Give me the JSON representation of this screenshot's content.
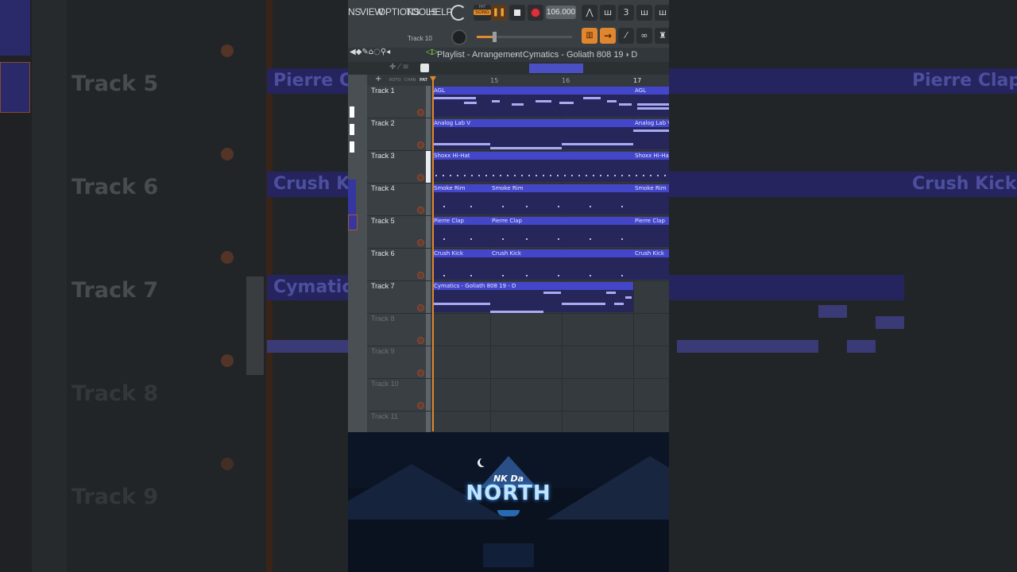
{
  "menu": {
    "items": [
      "NS",
      "VIEW",
      "OPTIONS",
      "TOOLS",
      "HELP"
    ]
  },
  "transport": {
    "pat_label": "PAT",
    "song_label": "SONG",
    "tempo": "106.000",
    "track_hint": "Track 10"
  },
  "titlebar": {
    "text": "Playlist - Arrangement",
    "sep": "›",
    "pattern": "Cymatics - Goliath 808 19 - D"
  },
  "ruler": {
    "bars": [
      "15",
      "16",
      "17"
    ],
    "labels": [
      "ROTO",
      "CHAN",
      "PAT"
    ]
  },
  "tracks": [
    {
      "name": "Track 1",
      "clips": [
        {
          "label": "AGL"
        },
        {
          "label": "AGL"
        }
      ]
    },
    {
      "name": "Track 2",
      "clips": [
        {
          "label": "Analog Lab V"
        },
        {
          "label": "Analog Lab V"
        }
      ]
    },
    {
      "name": "Track 3",
      "clips": [
        {
          "label": "Shoxx Hi-Hat"
        },
        {
          "label": "Shoxx Hi-Hat"
        }
      ]
    },
    {
      "name": "Track 4",
      "clips": [
        {
          "label": "Smoke Rim"
        },
        {
          "label": "Smoke Rim"
        },
        {
          "label": "Smoke Rim"
        }
      ]
    },
    {
      "name": "Track 5",
      "clips": [
        {
          "label": "Pierre Clap"
        },
        {
          "label": "Pierre Clap"
        },
        {
          "label": "Pierre Clap"
        }
      ]
    },
    {
      "name": "Track 6",
      "clips": [
        {
          "label": "Crush Kick"
        },
        {
          "label": "Crush Kick"
        },
        {
          "label": "Crush Kick"
        }
      ]
    },
    {
      "name": "Track 7",
      "clips": [
        {
          "label": "Cymatics - Goliath 808 19 - D"
        }
      ]
    },
    {
      "name": "Track 8",
      "clips": []
    },
    {
      "name": "Track 9",
      "clips": []
    },
    {
      "name": "Track 10",
      "clips": []
    },
    {
      "name": "Track 11",
      "clips": []
    }
  ],
  "background": {
    "tracks": [
      "Track 5",
      "Track 6",
      "Track 7",
      "Track 8",
      "Track 9"
    ],
    "clips": [
      "Pierre Clap",
      "Crush Kick",
      "Cymatics"
    ]
  },
  "brand": {
    "small": "NK Da",
    "big": "NORTH"
  },
  "colors": {
    "clip_header": "#4346c9",
    "clip_body": "#26265a",
    "note": "#a9aaf3",
    "playhead": "#e0862f"
  }
}
